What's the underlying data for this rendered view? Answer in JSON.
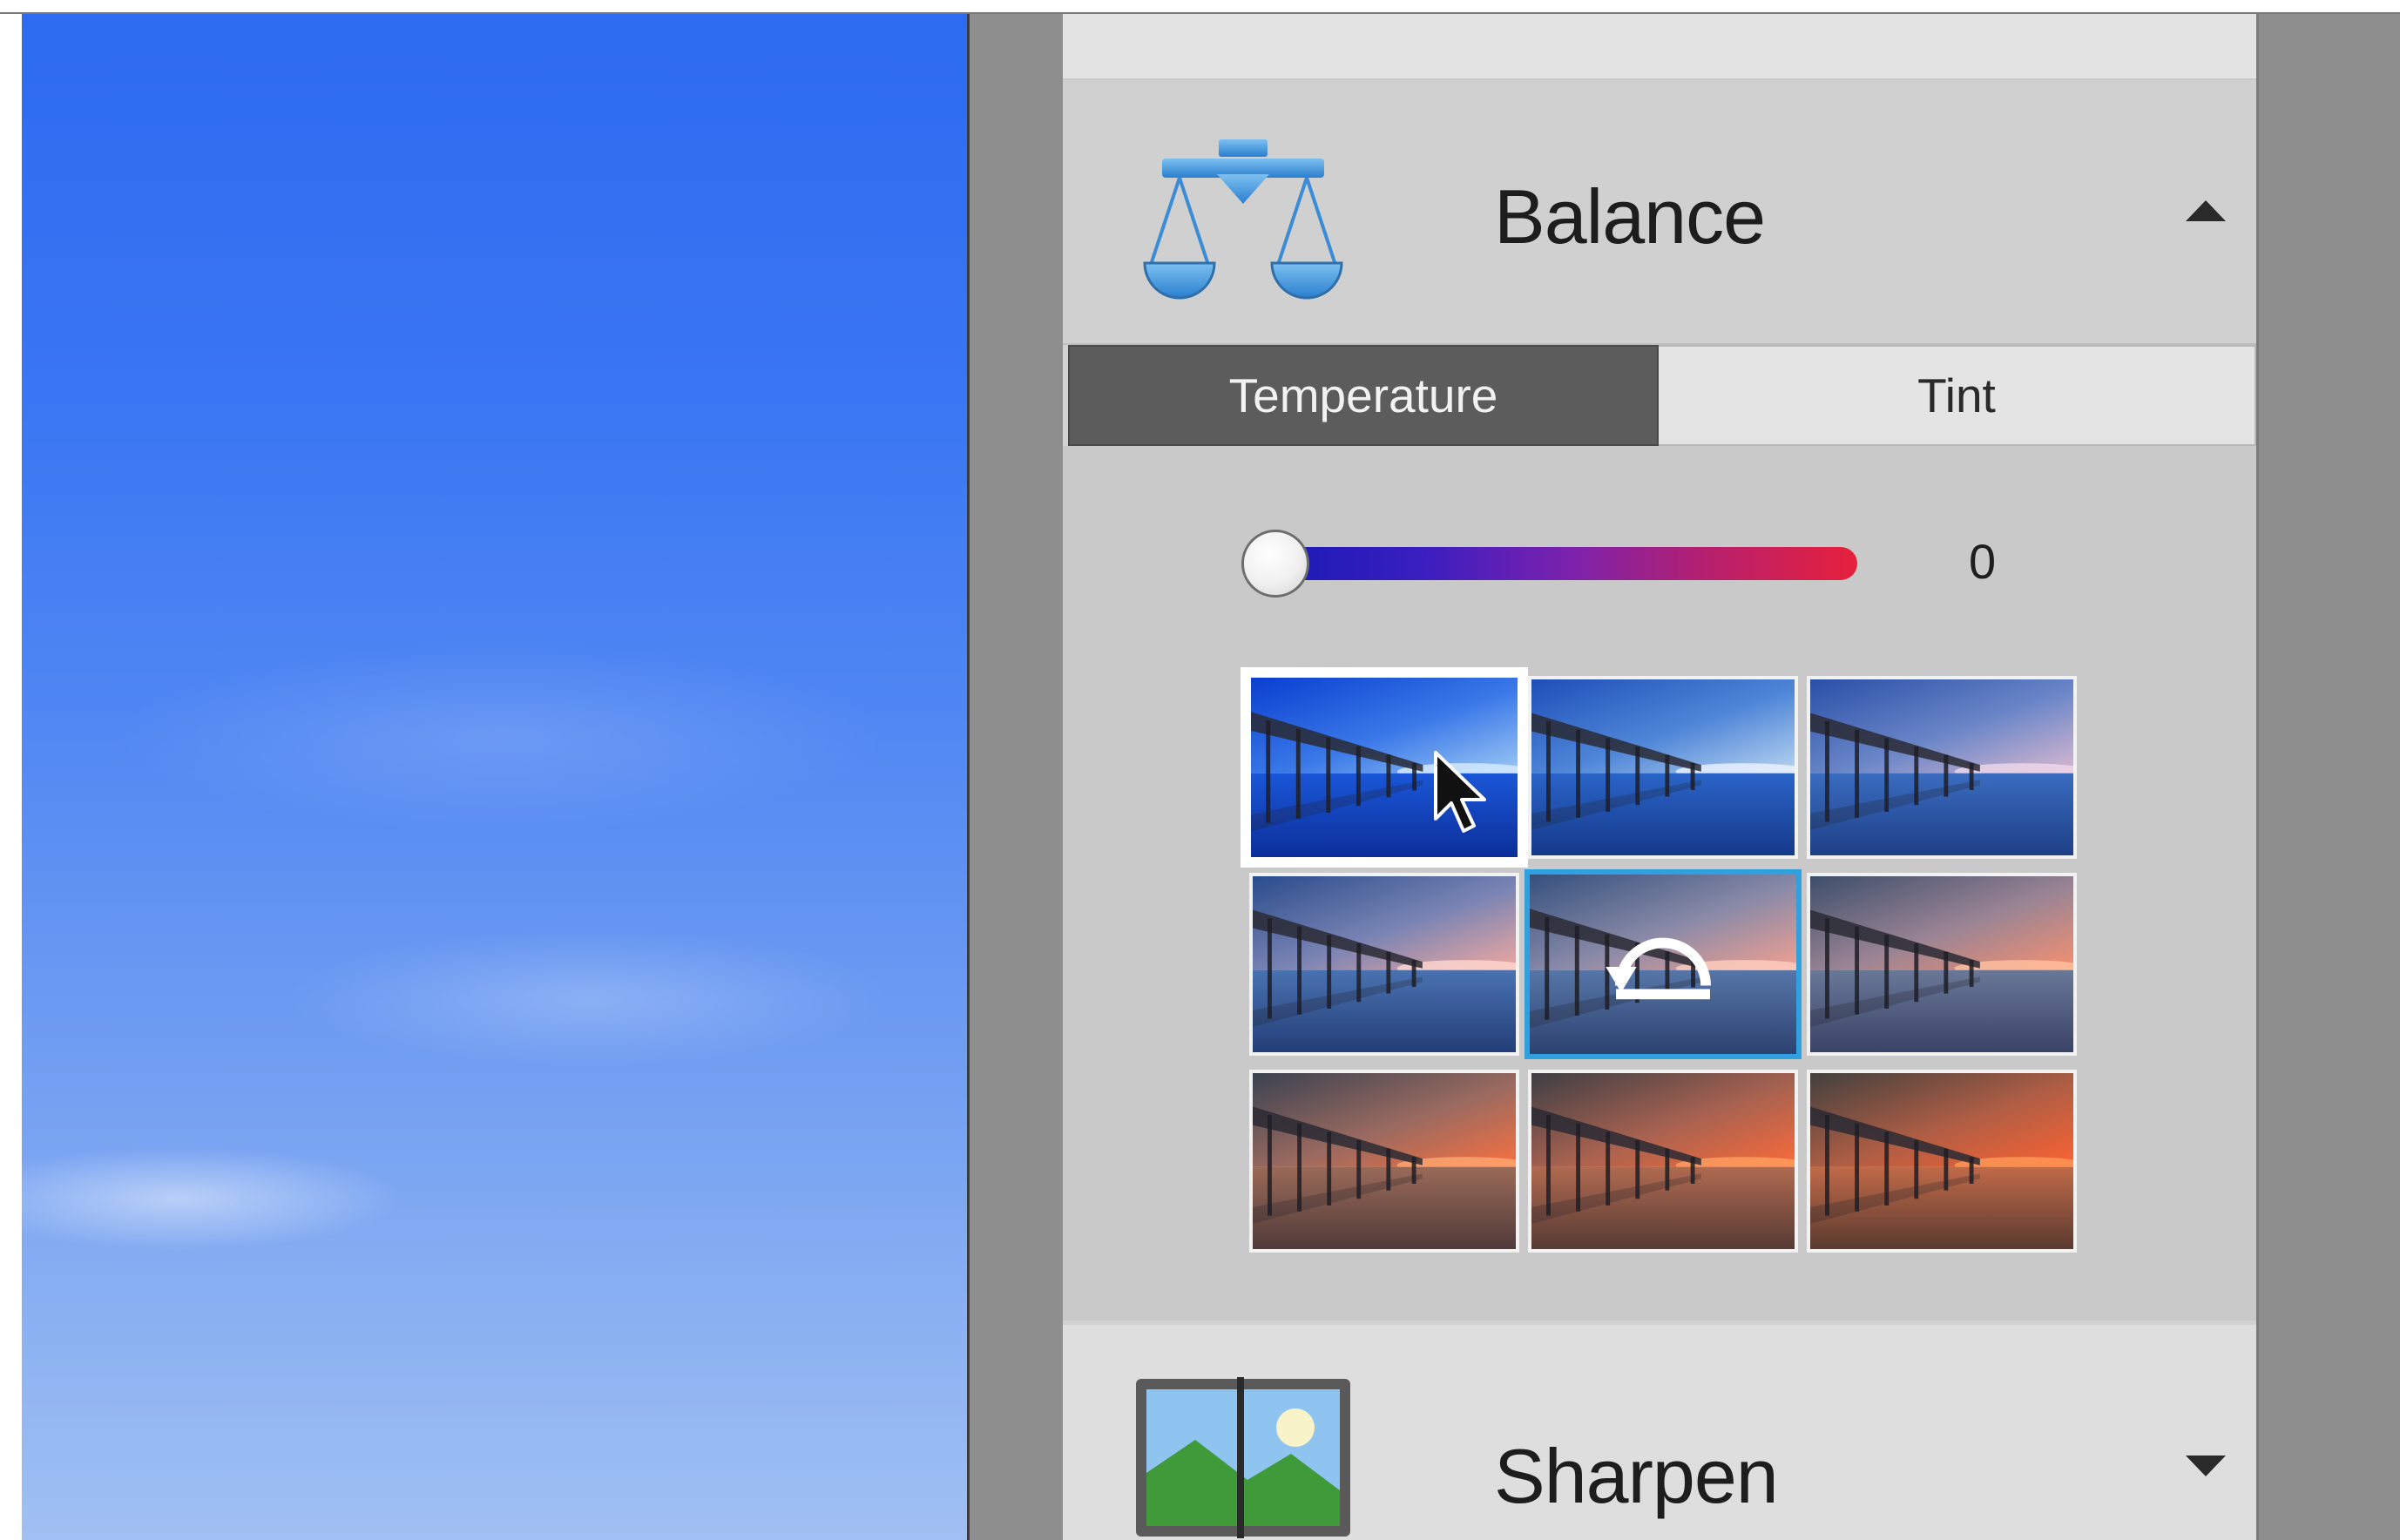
{
  "panel": {
    "sections": [
      {
        "title": "Balance",
        "icon": "balance-scale-icon",
        "toggle_icon": "chevron-up-icon",
        "expanded": true
      },
      {
        "title": "Sharpen",
        "icon": "sharpen-image-icon",
        "toggle_icon": "chevron-down-icon",
        "expanded": false
      }
    ],
    "tabs": [
      {
        "label": "Temperature",
        "active": true
      },
      {
        "label": "Tint",
        "active": false
      }
    ],
    "slider": {
      "value": "0",
      "fraction": 0.0
    },
    "presets": {
      "rows": 3,
      "cols": 3,
      "items": [
        {
          "tone": "cool-3",
          "state": "hovered"
        },
        {
          "tone": "cool-2",
          "state": "normal"
        },
        {
          "tone": "cool-1",
          "state": "normal"
        },
        {
          "tone": "neutral-cool",
          "state": "normal"
        },
        {
          "tone": "neutral",
          "state": "current",
          "overlay_icon": "reset-arrow-icon"
        },
        {
          "tone": "warm-1",
          "state": "normal"
        },
        {
          "tone": "warm-2",
          "state": "normal"
        },
        {
          "tone": "warm-3",
          "state": "normal"
        },
        {
          "tone": "warm-4",
          "state": "normal"
        }
      ]
    }
  },
  "colors": {
    "accent_blue": "#2fa0e0",
    "active_tab": "#5c5c5c",
    "panel_bg": "#d2d2d2",
    "slider_start": "#1a1ab4",
    "slider_end": "#e6203c"
  }
}
